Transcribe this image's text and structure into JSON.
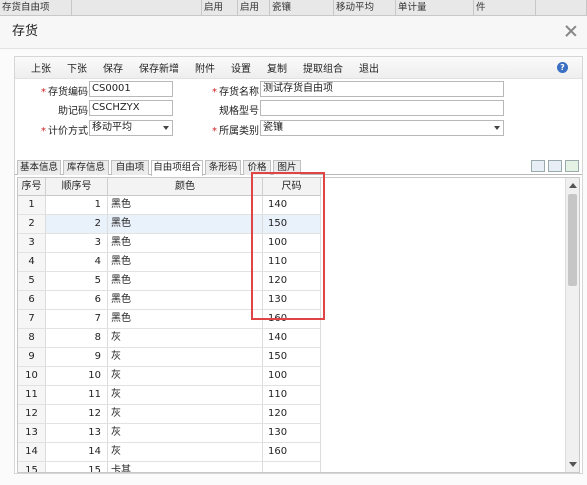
{
  "background_header": {
    "cells": [
      "存货自由项",
      "",
      "启用",
      "启用",
      "瓷镶",
      "移动平均",
      "单计量",
      "件",
      ""
    ]
  },
  "dialog": {
    "title": "存货"
  },
  "toolbar": {
    "buttons": [
      "上张",
      "下张",
      "保存",
      "保存新增",
      "附件",
      "设置",
      "复制",
      "提取组合",
      "退出"
    ],
    "help_icon": "help-icon"
  },
  "form": {
    "code_label": "存货编码",
    "code_value": "CS0001",
    "name_label": "存货名称",
    "name_value": "测试存货自由项",
    "mnemonic_label": "助记码",
    "mnemonic_value": "CSCHZYX",
    "spec_label": "规格型号",
    "spec_value": "",
    "pricing_label": "计价方式",
    "pricing_value": "移动平均",
    "category_label": "所属类别",
    "category_value": "瓷镶"
  },
  "tabs": [
    "基本信息",
    "库存信息",
    "自由项",
    "自由项组合",
    "条形码",
    "价格",
    "图片"
  ],
  "active_tab": "自由项组合",
  "grid": {
    "headers": [
      "序号",
      "顺序号",
      "颜色",
      "尺码"
    ],
    "rows": [
      {
        "seq": "1",
        "order": "1",
        "color": "黑色",
        "size": "140"
      },
      {
        "seq": "2",
        "order": "2",
        "color": "黑色",
        "size": "150"
      },
      {
        "seq": "3",
        "order": "3",
        "color": "黑色",
        "size": "100"
      },
      {
        "seq": "4",
        "order": "4",
        "color": "黑色",
        "size": "110"
      },
      {
        "seq": "5",
        "order": "5",
        "color": "黑色",
        "size": "120"
      },
      {
        "seq": "6",
        "order": "6",
        "color": "黑色",
        "size": "130"
      },
      {
        "seq": "7",
        "order": "7",
        "color": "黑色",
        "size": "160"
      },
      {
        "seq": "8",
        "order": "8",
        "color": "灰",
        "size": "140"
      },
      {
        "seq": "9",
        "order": "9",
        "color": "灰",
        "size": "150"
      },
      {
        "seq": "10",
        "order": "10",
        "color": "灰",
        "size": "100"
      },
      {
        "seq": "11",
        "order": "11",
        "color": "灰",
        "size": "110"
      },
      {
        "seq": "12",
        "order": "12",
        "color": "灰",
        "size": "120"
      },
      {
        "seq": "13",
        "order": "13",
        "color": "灰",
        "size": "130"
      },
      {
        "seq": "14",
        "order": "14",
        "color": "灰",
        "size": "160"
      },
      {
        "seq": "15",
        "order": "15",
        "color": "卡其",
        "size": ""
      }
    ]
  },
  "colors": {
    "required_marker": "#d02020",
    "highlight_box": "#e04545",
    "selected_row": "#e9f1fb"
  }
}
